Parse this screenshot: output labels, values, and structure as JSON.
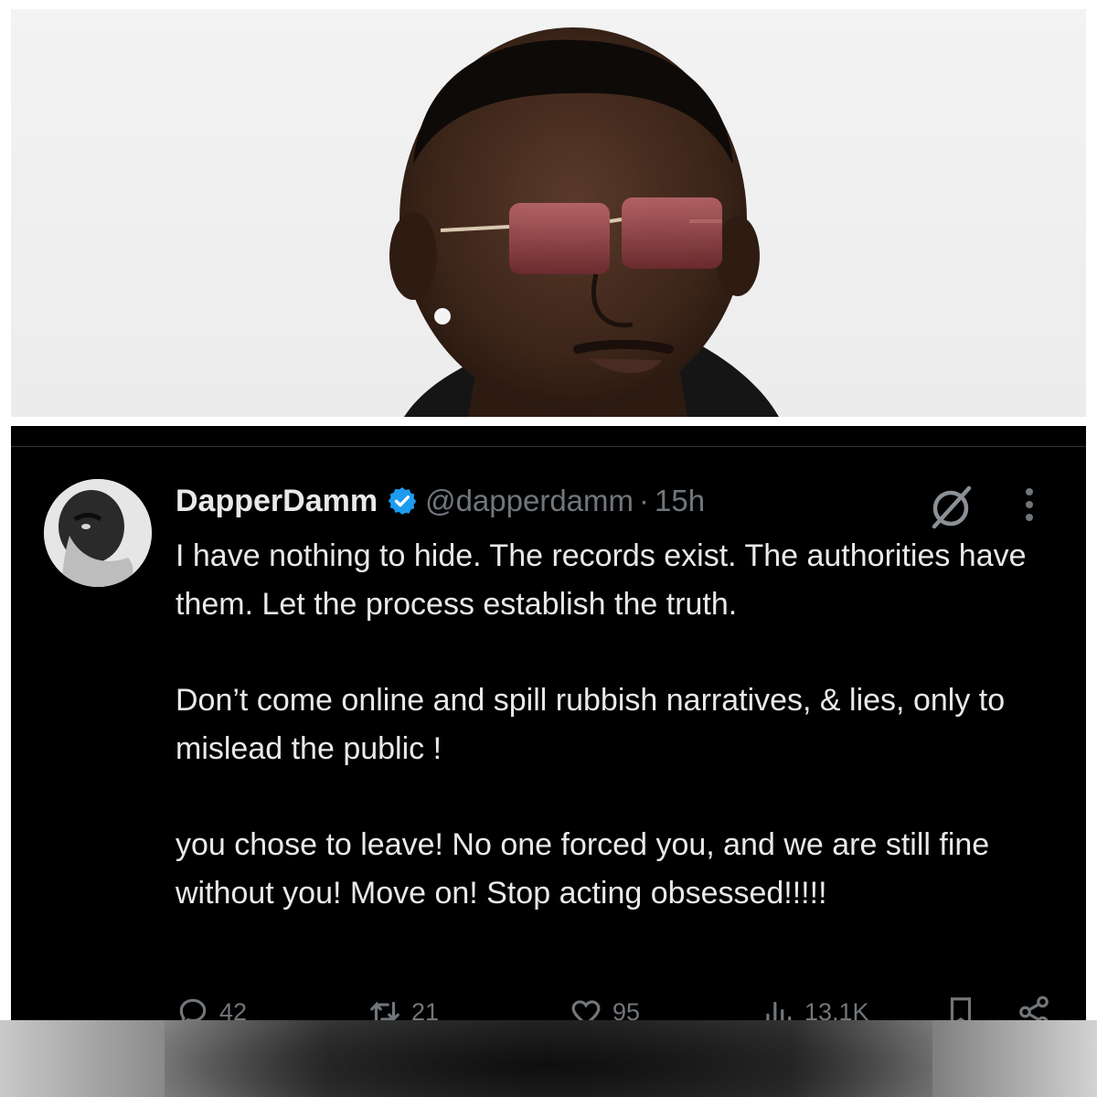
{
  "tweet": {
    "display_name": "DapperDamm",
    "handle": "@dapperdamm",
    "separator": "·",
    "timestamp": "15h",
    "paragraphs": [
      "I have nothing to hide. The records exist. The authorities have them. Let the process establish the truth.",
      "Don’t come online and spill rubbish narratives, & lies, only to mislead the public !",
      "you chose to leave! No one forced you, and we are still fine without you! Move on! Stop acting obsessed!!!!!"
    ],
    "metrics": {
      "replies": "42",
      "reposts": "21",
      "likes": "95",
      "views": "13.1K"
    }
  },
  "colors": {
    "card_background": "#000000",
    "text_primary": "#e7e9ea",
    "text_secondary": "#71767b",
    "verified_badge": "#1d9bf0"
  },
  "icons": [
    "verified-badge-icon",
    "grok-icon",
    "more-icon",
    "reply-icon",
    "repost-icon",
    "like-icon",
    "views-icon",
    "bookmark-icon",
    "share-icon"
  ]
}
